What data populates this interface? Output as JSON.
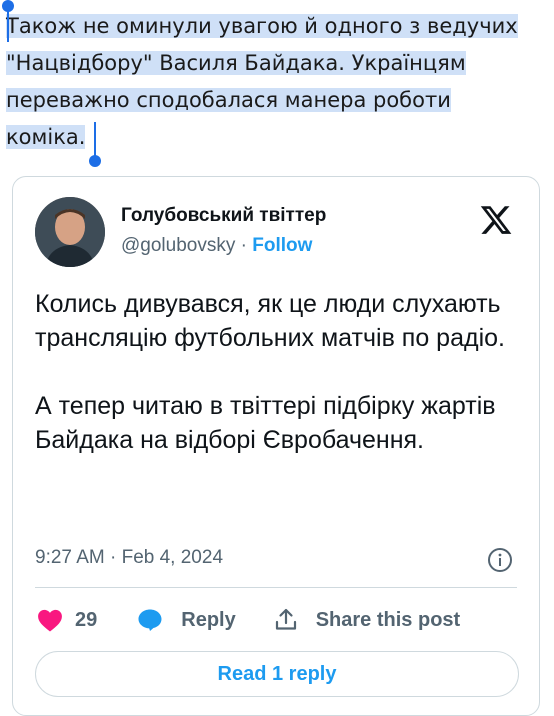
{
  "article": {
    "lines": [
      "Також не оминули увагою й одного з ведучих",
      "\"Нацвідбору\" Василя Байдака. Українцям",
      "переважно сподобалася манера роботи",
      "коміка."
    ],
    "selection_color": "#cfe0f7",
    "handle_color": "#1d6ee6"
  },
  "tweet": {
    "author_name": "Голубовський твіттер",
    "handle": "@golubovsky",
    "separator": "·",
    "follow_label": "Follow",
    "paragraphs": [
      "Колись дивувався, як це люди слухають трансляцію футбольних матчів по радіо.",
      "А тепер читаю в твіттері підбірку жартів Байдака на відборі Євробачення."
    ],
    "timestamp": "9:27 AM · Feb 4, 2024",
    "likes": "29",
    "reply_label": "Reply",
    "share_label": "Share this post",
    "read_replies_label": "Read 1 reply",
    "icons": [
      "x-logo-icon",
      "info-icon",
      "heart-icon",
      "reply-bubble-icon",
      "share-icon"
    ],
    "accent_color": "#1d9bf0",
    "like_color": "#f91880"
  }
}
